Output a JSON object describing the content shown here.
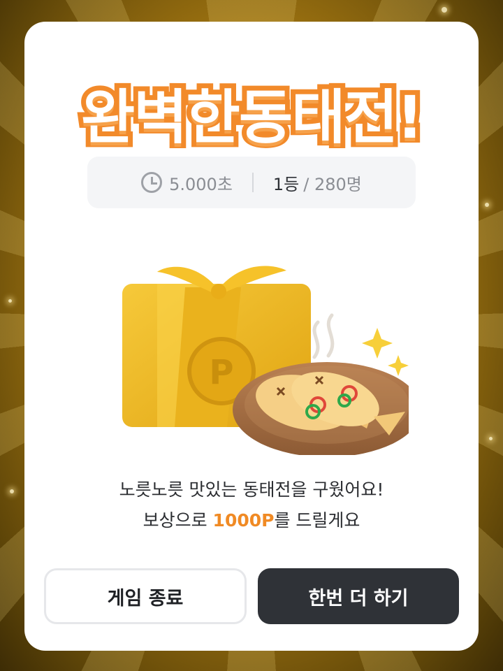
{
  "title": "완벽한동태전!",
  "stats": {
    "time": "5.000초",
    "rank": "1등",
    "total": "/ 280명",
    "clock_icon": "clock-icon"
  },
  "reward": {
    "message_line1": "노릇노릇 맛있는 동태전을 구웠어요!",
    "message_pre": "보상으로 ",
    "points": "1000P",
    "message_post": "를 드릴게요",
    "coin_letter": "P"
  },
  "buttons": {
    "exit_label": "게임 종료",
    "retry_label": "한번 더 하기"
  },
  "colors": {
    "accent": "#f08a24",
    "title_outline": "#f28a2a",
    "dark_button": "#2f3237"
  }
}
